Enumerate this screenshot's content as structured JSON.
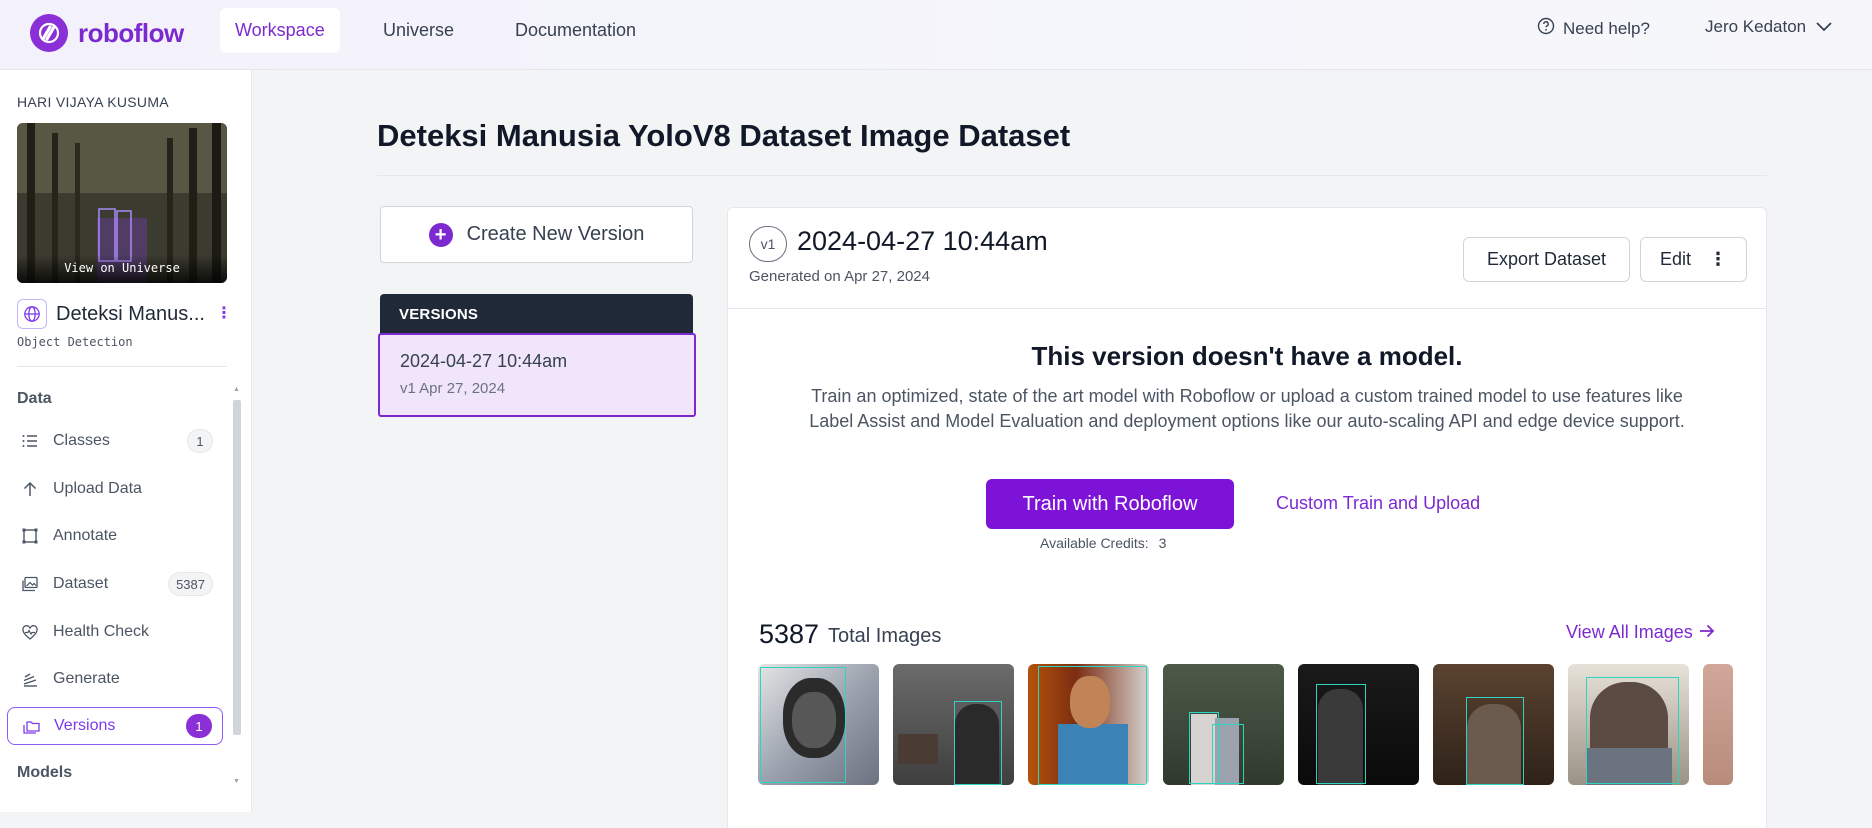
{
  "nav": {
    "logo_text": "roboflow",
    "tabs": [
      {
        "label": "Workspace",
        "active": true
      },
      {
        "label": "Universe",
        "active": false
      },
      {
        "label": "Documentation",
        "active": false
      }
    ],
    "help_label": "Need help?",
    "user_name": "Jero Kedaton"
  },
  "sidebar": {
    "workspace_name": "HARI VIJAYA KUSUMA",
    "view_on_universe": "View on Universe",
    "project_name": "Deteksi Manus...",
    "project_type": "Object Detection",
    "sections": {
      "data": "Data",
      "models": "Models"
    },
    "items": [
      {
        "label": "Classes",
        "icon": "list-icon",
        "badge": "1"
      },
      {
        "label": "Upload Data",
        "icon": "arrow-up-icon",
        "badge": ""
      },
      {
        "label": "Annotate",
        "icon": "annotate-icon",
        "badge": ""
      },
      {
        "label": "Dataset",
        "icon": "images-icon",
        "badge": "5387"
      },
      {
        "label": "Health Check",
        "icon": "heart-pulse-icon",
        "badge": ""
      },
      {
        "label": "Generate",
        "icon": "generate-icon",
        "badge": ""
      },
      {
        "label": "Versions",
        "icon": "folders-icon",
        "badge": "1",
        "active": true
      }
    ]
  },
  "main": {
    "page_title": "Deteksi Manusia YoloV8 Dataset Image Dataset",
    "create_version_label": "Create New Version",
    "versions_header": "VERSIONS",
    "versions": [
      {
        "date": "2024-04-27 10:44am",
        "meta": "v1 Apr 27, 2024"
      }
    ]
  },
  "version_panel": {
    "version_pill": "v1",
    "title": "2024-04-27 10:44am",
    "generated": "Generated on Apr 27, 2024",
    "export_label": "Export Dataset",
    "edit_label": "Edit",
    "no_model_heading": "This version doesn't have a model.",
    "description": "Train an optimized, state of the art model with Roboflow or upload a custom trained model to use features like Label Assist and Model Evaluation and deployment options like our auto-scaling API and edge device support.",
    "train_label": "Train with Roboflow",
    "custom_label": "Custom Train and Upload",
    "credits_label": "Available Credits:",
    "credits_value": "3",
    "total_images_count": "5387",
    "total_images_label": "Total Images",
    "view_all_label": "View All Images"
  },
  "colors": {
    "brand": "#7e13d8",
    "active_bg": "#f1e5fb",
    "header_dark": "#1f2937",
    "bbox": "#2dd4bf"
  }
}
